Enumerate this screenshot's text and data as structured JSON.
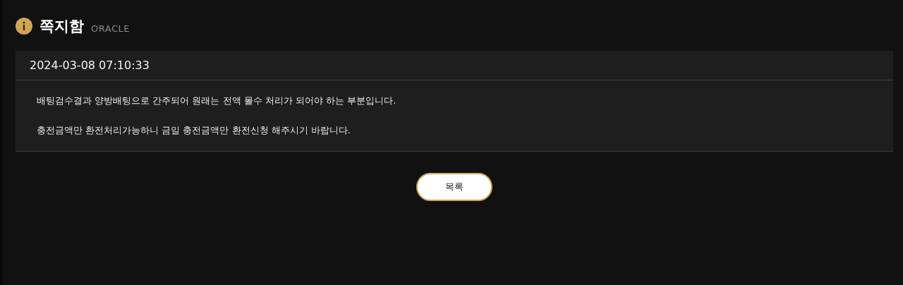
{
  "header": {
    "title": "쪽지함",
    "subtitle": "ORACLE"
  },
  "message": {
    "date": "2024-03-08 07:10:33",
    "paragraphs": [
      "배팅검수결과 양방배팅으로 간주되어 원래는 전액 몰수 처리가 되어야 하는 부분입니다.",
      "충전금액만 환전처리가능하니 금일 충전금액만 환전신청 해주시기 바랍니다."
    ]
  },
  "buttons": [
    "목록"
  ]
}
